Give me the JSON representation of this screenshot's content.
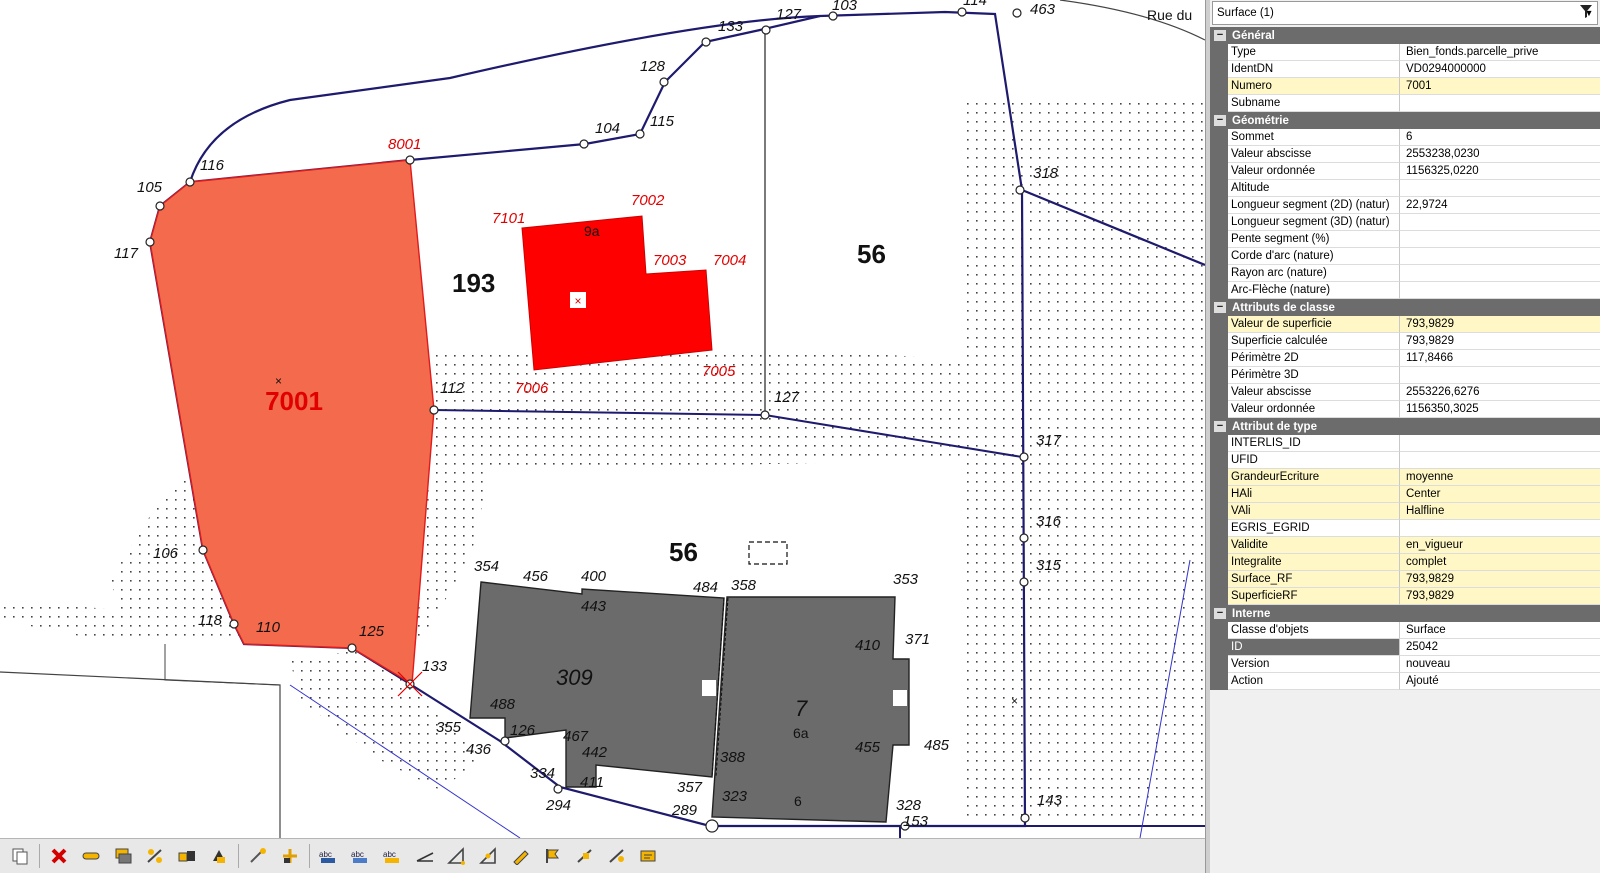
{
  "map": {
    "street_label": "Rue du",
    "point_labels": [
      "463",
      "114",
      "103",
      "127",
      "133",
      "128",
      "115",
      "104",
      "8001",
      "116",
      "105",
      "117",
      "318",
      "112",
      "127",
      "317",
      "316",
      "315",
      "106",
      "118",
      "110",
      "125",
      "133",
      "354",
      "456",
      "400",
      "443",
      "484",
      "358",
      "353",
      "410",
      "371",
      "488",
      "355",
      "126",
      "436",
      "467",
      "442",
      "334",
      "411",
      "357",
      "388",
      "323",
      "294",
      "289",
      "328",
      "153",
      "485",
      "455",
      "143"
    ],
    "red_labels": [
      "7101",
      "7002",
      "7003",
      "7004",
      "7006",
      "7005",
      "8001"
    ],
    "parcel_labels": {
      "p193": "193",
      "p56_top": "56",
      "p56_mid": "56",
      "p7001": "7001",
      "b9a": "9a",
      "b309": "309",
      "b7": "7",
      "b6a": "6a",
      "b6": "6"
    },
    "colors": {
      "parcel_fill": "#f36a4c",
      "building_red": "#ff0000",
      "building_gray": "#6b6b6b",
      "boundary": "#1e1a6e"
    }
  },
  "panel": {
    "selector_value": "Surface (1)",
    "categories": [
      {
        "title": "Général",
        "rows": [
          {
            "k": "Type",
            "v": "Bien_fonds.parcelle_prive",
            "hl": false
          },
          {
            "k": "IdentDN",
            "v": "VD0294000000",
            "hl": false
          },
          {
            "k": "Numero",
            "v": "7001",
            "hl": true
          },
          {
            "k": "Subname",
            "v": "",
            "hl": false
          }
        ]
      },
      {
        "title": "Géométrie",
        "rows": [
          {
            "k": "Sommet",
            "v": "6",
            "hl": false
          },
          {
            "k": "Valeur abscisse",
            "v": "2553238,0230",
            "hl": false
          },
          {
            "k": "Valeur ordonnée",
            "v": "1156325,0220",
            "hl": false
          },
          {
            "k": "Altitude",
            "v": "",
            "hl": false
          },
          {
            "k": "Longueur segment (2D) (natur)",
            "v": "22,9724",
            "hl": false
          },
          {
            "k": "Longueur segment (3D) (natur)",
            "v": "",
            "hl": false
          },
          {
            "k": "Pente segment (%)",
            "v": "",
            "hl": false
          },
          {
            "k": "Corde d'arc (nature)",
            "v": "",
            "hl": false
          },
          {
            "k": "Rayon arc (nature)",
            "v": "",
            "hl": false
          },
          {
            "k": "Arc-Flèche (nature)",
            "v": "",
            "hl": false
          }
        ]
      },
      {
        "title": "Attributs de classe",
        "rows": [
          {
            "k": "Valeur de superficie",
            "v": "793,9829",
            "hl": true
          },
          {
            "k": "Superficie calculée",
            "v": "793,9829",
            "hl": false
          },
          {
            "k": "Périmètre 2D",
            "v": "117,8466",
            "hl": false
          },
          {
            "k": "Périmètre 3D",
            "v": "",
            "hl": false
          },
          {
            "k": "Valeur abscisse",
            "v": "2553226,6276",
            "hl": false
          },
          {
            "k": "Valeur ordonnée",
            "v": "1156350,3025",
            "hl": false
          }
        ]
      },
      {
        "title": "Attribut de type",
        "rows": [
          {
            "k": "INTERLIS_ID",
            "v": "",
            "hl": false
          },
          {
            "k": "UFID",
            "v": "",
            "hl": false
          },
          {
            "k": "GrandeurEcriture",
            "v": "moyenne",
            "hl": true
          },
          {
            "k": "HAli",
            "v": "Center",
            "hl": true
          },
          {
            "k": "VAli",
            "v": "Halfline",
            "hl": true
          },
          {
            "k": "EGRIS_EGRID",
            "v": "",
            "hl": false
          },
          {
            "k": "Validite",
            "v": "en_vigueur",
            "hl": true
          },
          {
            "k": "Integralite",
            "v": "complet",
            "hl": true
          },
          {
            "k": "Surface_RF",
            "v": "793,9829",
            "hl": true
          },
          {
            "k": "SuperficieRF",
            "v": "793,9829",
            "hl": true
          }
        ]
      },
      {
        "title": "Interne",
        "rows": [
          {
            "k": "Classe d'objets",
            "v": "Surface",
            "hl": false
          },
          {
            "k": "ID",
            "v": "25042",
            "hl": false,
            "sel": true
          },
          {
            "k": "Version",
            "v": "nouveau",
            "hl": false
          },
          {
            "k": "Action",
            "v": "Ajouté",
            "hl": false
          }
        ]
      }
    ]
  },
  "toolbar": {
    "icons": [
      "copy-icon",
      "delete-icon",
      "arrows-icon",
      "layers-icon",
      "split-icon",
      "boxes-icon",
      "paint-icon",
      "wand-icon",
      "add-point-icon",
      "abc-icon",
      "abc2-icon",
      "abc3-icon",
      "angle-icon",
      "measure-icon",
      "measure2-icon",
      "pencil-icon",
      "flag-icon",
      "snap-icon",
      "snap2-icon",
      "label-icon"
    ]
  }
}
